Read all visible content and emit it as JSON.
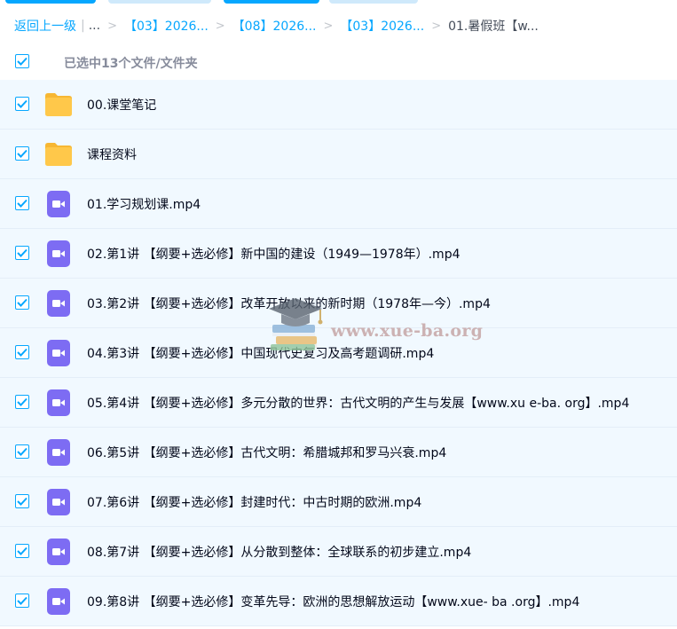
{
  "breadcrumb": {
    "back_label": "返回上一级",
    "bar": "|",
    "ellipsis": "...",
    "sep": ">",
    "items": [
      "【03】2026...",
      "【08】2026...",
      "【03】2026..."
    ],
    "current": "01.暑假班【w..."
  },
  "selection": {
    "count_text": "已选中13个文件/文件夹",
    "all_checked": true
  },
  "files": [
    {
      "name": "00.课堂笔记",
      "type": "folder",
      "checked": true
    },
    {
      "name": "课程资料",
      "type": "folder",
      "checked": true
    },
    {
      "name": "01.学习规划课.mp4",
      "type": "video",
      "checked": true
    },
    {
      "name": "02.第1讲 【纲要+选必修】新中国的建设（1949—1978年）.mp4",
      "type": "video",
      "checked": true
    },
    {
      "name": "03.第2讲 【纲要+选必修】改革开放以来的新时期（1978年—今）.mp4",
      "type": "video",
      "checked": true
    },
    {
      "name": "04.第3讲 【纲要+选必修】中国现代史复习及高考题调研.mp4",
      "type": "video",
      "checked": true
    },
    {
      "name": "05.第4讲 【纲要+选必修】多元分散的世界：古代文明的产生与发展【www.xu e-ba. org】.mp4",
      "type": "video",
      "checked": true
    },
    {
      "name": "06.第5讲 【纲要+选必修】古代文明：希腊城邦和罗马兴衰.mp4",
      "type": "video",
      "checked": true
    },
    {
      "name": "07.第6讲 【纲要+选必修】封建时代：中古时期的欧洲.mp4",
      "type": "video",
      "checked": true
    },
    {
      "name": "08.第7讲 【纲要+选必修】从分散到整体：全球联系的初步建立.mp4",
      "type": "video",
      "checked": true
    },
    {
      "name": "09.第8讲 【纲要+选必修】变革先导：欧洲的思想解放运动【www.xue- ba .org】.mp4",
      "type": "video",
      "checked": true
    }
  ],
  "watermark": {
    "text": "www.xue-ba.org",
    "icon": "graduation-cap-books-icon"
  },
  "icons": {
    "folder": "folder-icon",
    "video": "video-file-icon",
    "checkbox": "check-icon"
  },
  "colors": {
    "accent": "#06a7ff",
    "row_bg": "#f1f9ff",
    "folder": "#ffc84a",
    "video": "#7d6cf3",
    "text": "#03081a",
    "muted": "#878c9c"
  }
}
